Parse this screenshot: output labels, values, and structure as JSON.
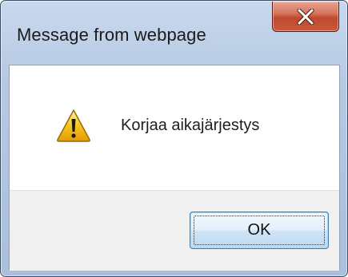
{
  "dialog": {
    "title": "Message from webpage",
    "close_icon": "close-icon",
    "message": "Korjaa aikajärjestys",
    "icon": "warning-icon",
    "ok_label": "OK"
  },
  "colors": {
    "close_button": "#c9583a",
    "title_bar": "#b5c9e3",
    "footer": "#f0f0f0",
    "ok_border": "#3c7fb1",
    "warning_yellow": "#f7c51d"
  }
}
